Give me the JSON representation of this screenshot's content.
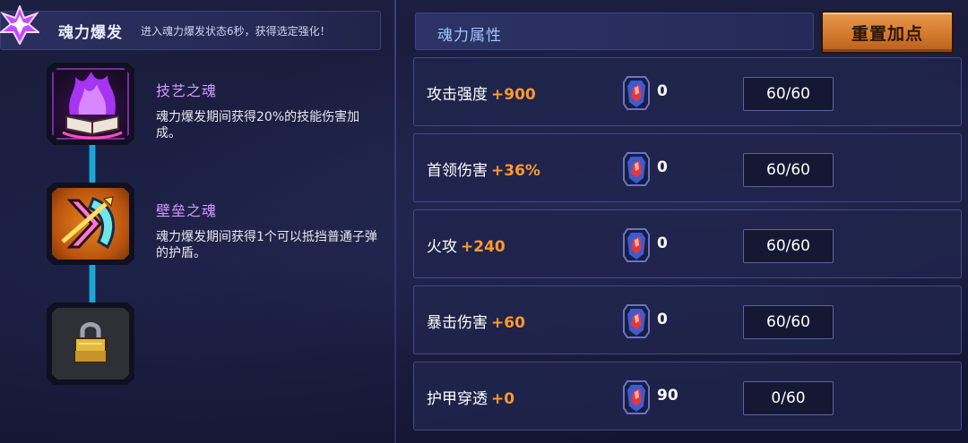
{
  "burst": {
    "title": "魂力爆发",
    "description": "进入魂力爆发状态6秒，获得选定强化！",
    "icon": "purple-star-gem-icon"
  },
  "souls": [
    {
      "name": "技艺之魂",
      "description": "魂力爆发期间获得20%的技能伤害加成。",
      "icon": "purple-flame-book-icon",
      "locked": false
    },
    {
      "name": "壁垒之魂",
      "description": "魂力爆发期间获得1个可以抵挡普通子弹的护盾。",
      "icon": "shield-arrow-icon",
      "locked": false
    },
    {
      "name": "",
      "description": "",
      "icon": "padlock-icon",
      "locked": true
    }
  ],
  "attributes_panel": {
    "title": "魂力属性",
    "reset_label": "重置加点"
  },
  "attributes": [
    {
      "label": "攻击强度",
      "bonus": "+900",
      "gems": "0",
      "level": "60/60"
    },
    {
      "label": "首领伤害",
      "bonus": "+36%",
      "gems": "0",
      "level": "60/60"
    },
    {
      "label": "火攻",
      "bonus": "+240",
      "gems": "0",
      "level": "60/60"
    },
    {
      "label": "暴击伤害",
      "bonus": "+60",
      "gems": "0",
      "level": "60/60"
    },
    {
      "label": "护甲穿透",
      "bonus": "+0",
      "gems": "90",
      "level": "0/60"
    }
  ],
  "colors": {
    "bonus": "#ff9a2e",
    "soul_name": "#d59bff",
    "reset_button": "#d47a2f",
    "connector": "#1fa5d4"
  }
}
